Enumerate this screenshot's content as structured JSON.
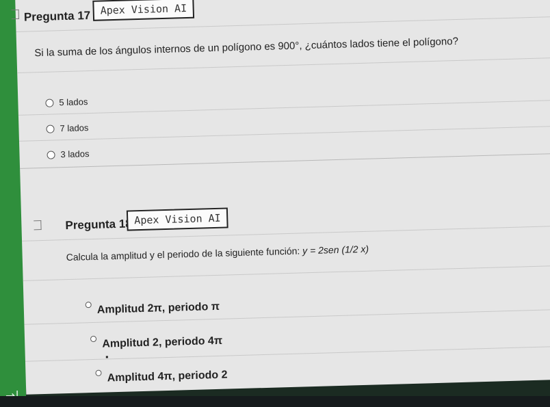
{
  "colors": {
    "sidebar": "#2f8f3c",
    "sheet": "#e6e6e6",
    "badge_border": "#222222"
  },
  "sidebar": {
    "nav_icon": "arrow-right-to-bar-icon",
    "nav_glyph": "→|"
  },
  "q17": {
    "title": "Pregunta 17",
    "badge": "Apex Vision AI",
    "question": "Si la suma de los ángulos internos de un polígono es 900°, ¿cuántos lados tiene el polígono?",
    "options": [
      "5 lados",
      "7 lados",
      "3 lados"
    ]
  },
  "q18": {
    "title": "Pregunta 18",
    "badge": "Apex Vision AI",
    "question": "Calcula la amplitud y el periodo de la siguiente función:",
    "formula": "y = 2sen (1/2 x)",
    "options": [
      "Amplitud 2π, periodo π",
      "Amplitud 2, periodo 4π",
      "Amplitud 4π, periodo 2"
    ]
  }
}
